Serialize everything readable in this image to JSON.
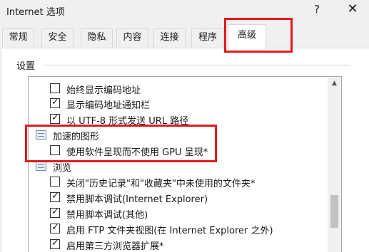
{
  "window": {
    "title": "Internet 选项",
    "help_glyph": "?",
    "close_glyph": "✕"
  },
  "tabs": [
    {
      "label": "常规"
    },
    {
      "label": "安全"
    },
    {
      "label": "隐私"
    },
    {
      "label": "内容"
    },
    {
      "label": "连接"
    },
    {
      "label": "程序"
    },
    {
      "label": "高级",
      "selected": true
    }
  ],
  "section": {
    "label": "设置"
  },
  "settings": [
    {
      "type": "checkbox",
      "label": "始终显示编码地址",
      "checked": false
    },
    {
      "type": "checkbox",
      "label": "显示编码地址通知栏",
      "checked": true
    },
    {
      "type": "checkbox",
      "label": "以 UTF-8 形式发送 URL 路径",
      "checked": true
    },
    {
      "type": "category",
      "label": "加速的图形",
      "icon": "accelerated-graphics-icon"
    },
    {
      "type": "checkbox",
      "label": "使用软件呈现而不使用 GPU 呈现*",
      "checked": false
    },
    {
      "type": "category",
      "label": "浏览",
      "icon": "browsing-icon"
    },
    {
      "type": "checkbox",
      "label": "关闭\"历史记录\"和\"收藏夹\"中未使用的文件夹*",
      "checked": false
    },
    {
      "type": "checkbox",
      "label": "禁用脚本调试(Internet Explorer)",
      "checked": true
    },
    {
      "type": "checkbox",
      "label": "禁用脚本调试(其他)",
      "checked": true
    },
    {
      "type": "checkbox",
      "label": "启用 FTP 文件夹视图(在 Internet Explorer 之外)",
      "checked": true
    },
    {
      "type": "checkbox",
      "label": "启用第三方浏览器扩展*",
      "checked": true
    }
  ],
  "checkmark_glyph": "✓",
  "scrollbar": {
    "up_glyph": "▲",
    "scroll_fraction": 0.7
  },
  "annotation_color": "#e01b1b"
}
